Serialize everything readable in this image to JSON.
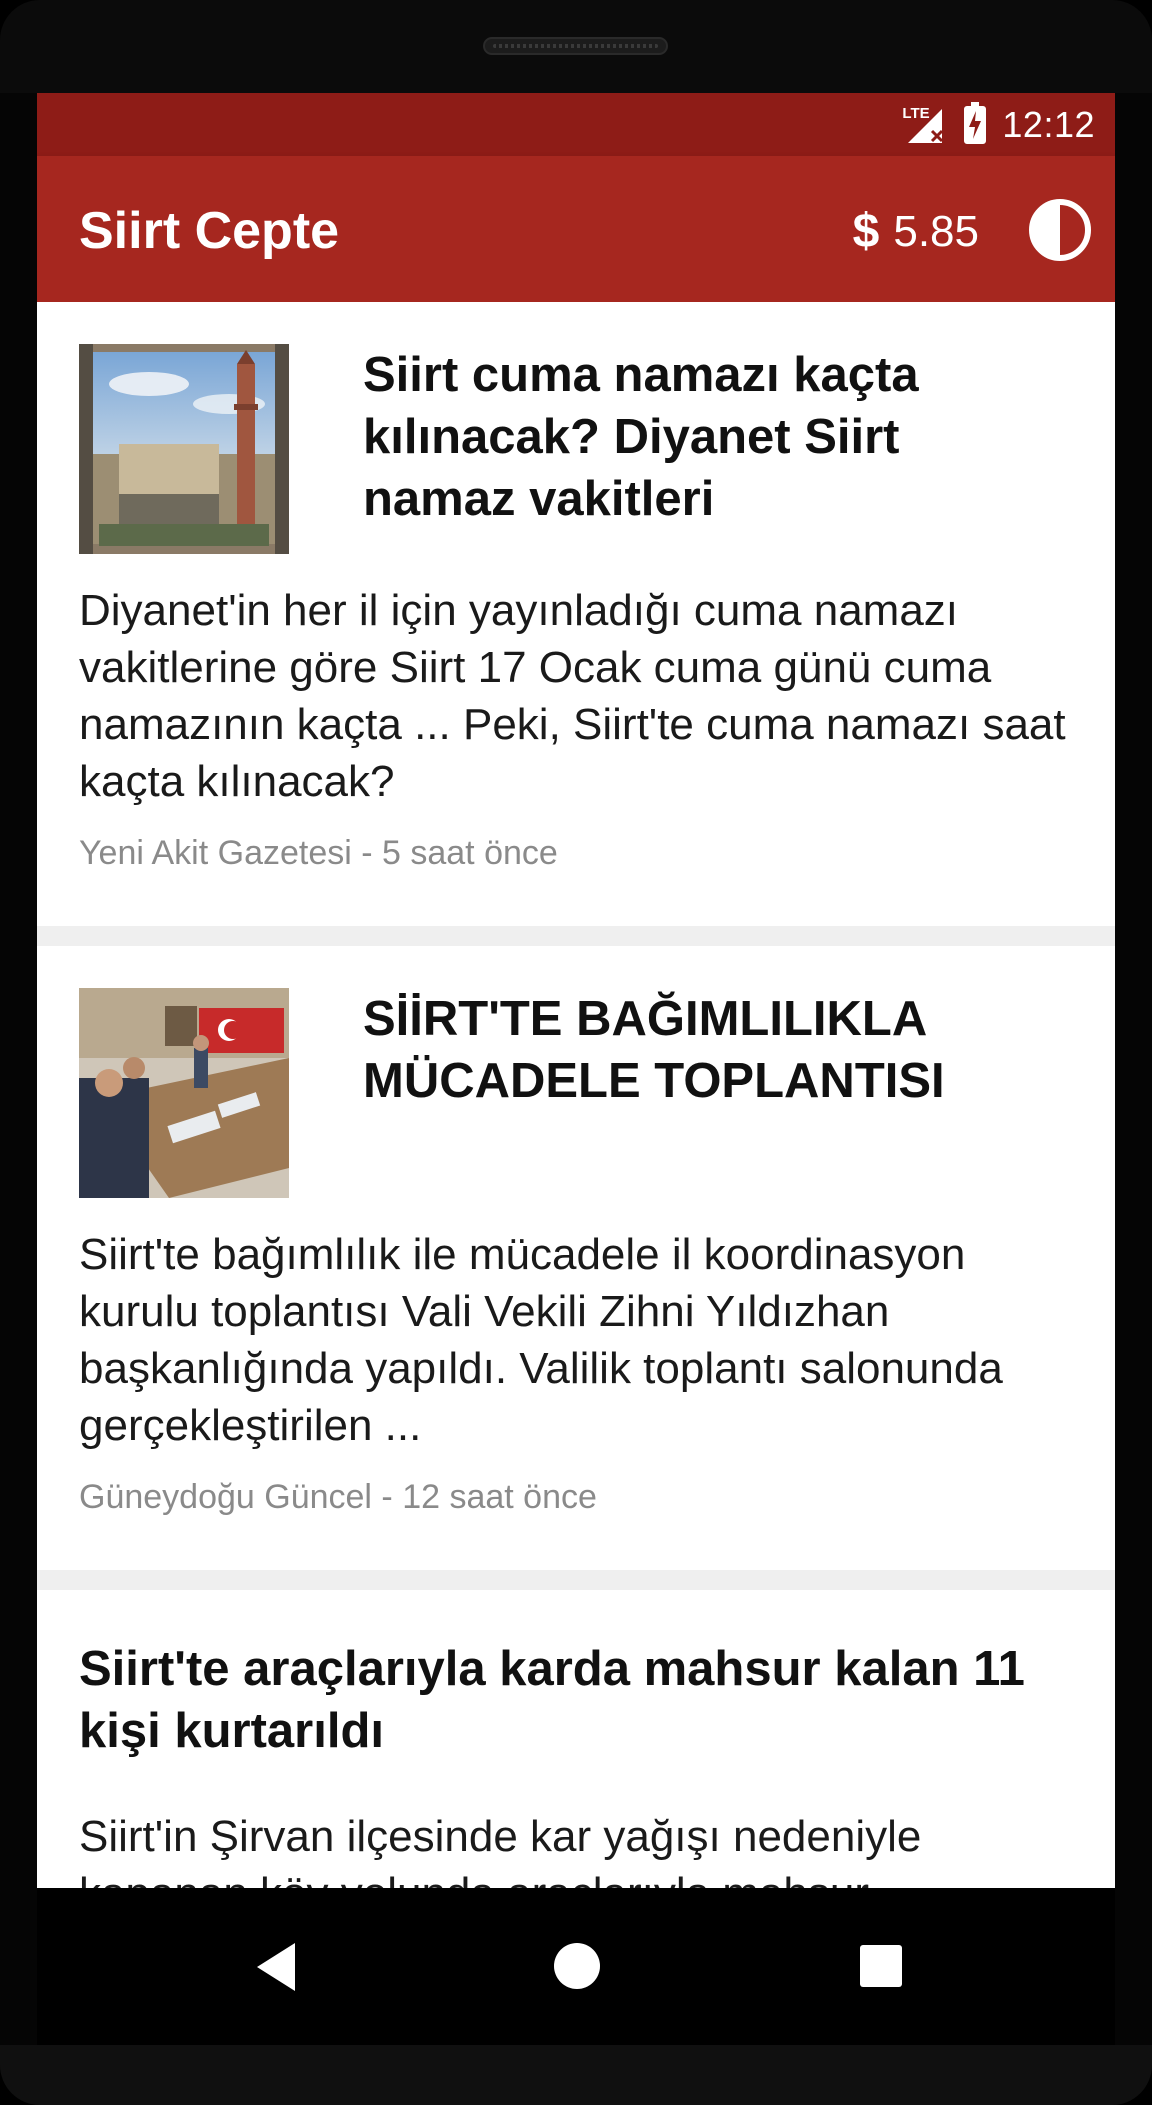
{
  "status_bar": {
    "network_label": "LTE",
    "time": "12:12"
  },
  "app_bar": {
    "title": "Siirt Cepte",
    "currency_symbol": "$",
    "currency_value": "5.85",
    "theme_toggle_icon": "contrast-icon"
  },
  "feed": [
    {
      "title": "Siirt cuma namazı kaçta kılınacak? Diyanet Siirt namaz vakitleri",
      "summary": "Diyanet'in her il için yayınladığı cuma namazı vakitlerine göre Siirt 17 Ocak cuma günü cuma namazının kaçta ... Peki, Siirt'te cuma namazı saat kaçta kılınacak?",
      "meta": "Yeni Akit Gazetesi - 5 saat önce",
      "thumbnail": "mosque-photo"
    },
    {
      "title": "SİİRT'TE BAĞIMLILIKLA MÜCADELE TOPLANTISI",
      "summary": "Siirt'te bağımlılık ile mücadele il koordinasyon kurulu toplantısı Vali Vekili Zihni Yıldızhan başkanlığında yapıldı. Valilik toplantı salonunda gerçekleştirilen ...",
      "meta": "Güneydoğu Güncel - 12 saat önce",
      "thumbnail": "meeting-photo"
    },
    {
      "title": "Siirt'te araçlarıyla karda mahsur kalan 11 kişi kurtarıldı",
      "summary": "Siirt'in Şirvan ilçesinde kar yağışı nedeniyle kapanan köy yolunda araçlarıyla mahsur"
    }
  ],
  "colors": {
    "status_bar": "#8e1c17",
    "app_bar": "#a6271f",
    "meta_text": "#8a8a8a"
  },
  "navigation": {
    "back_icon": "back-triangle-icon",
    "home_icon": "home-circle-icon",
    "recent_icon": "recent-apps-square-icon"
  }
}
